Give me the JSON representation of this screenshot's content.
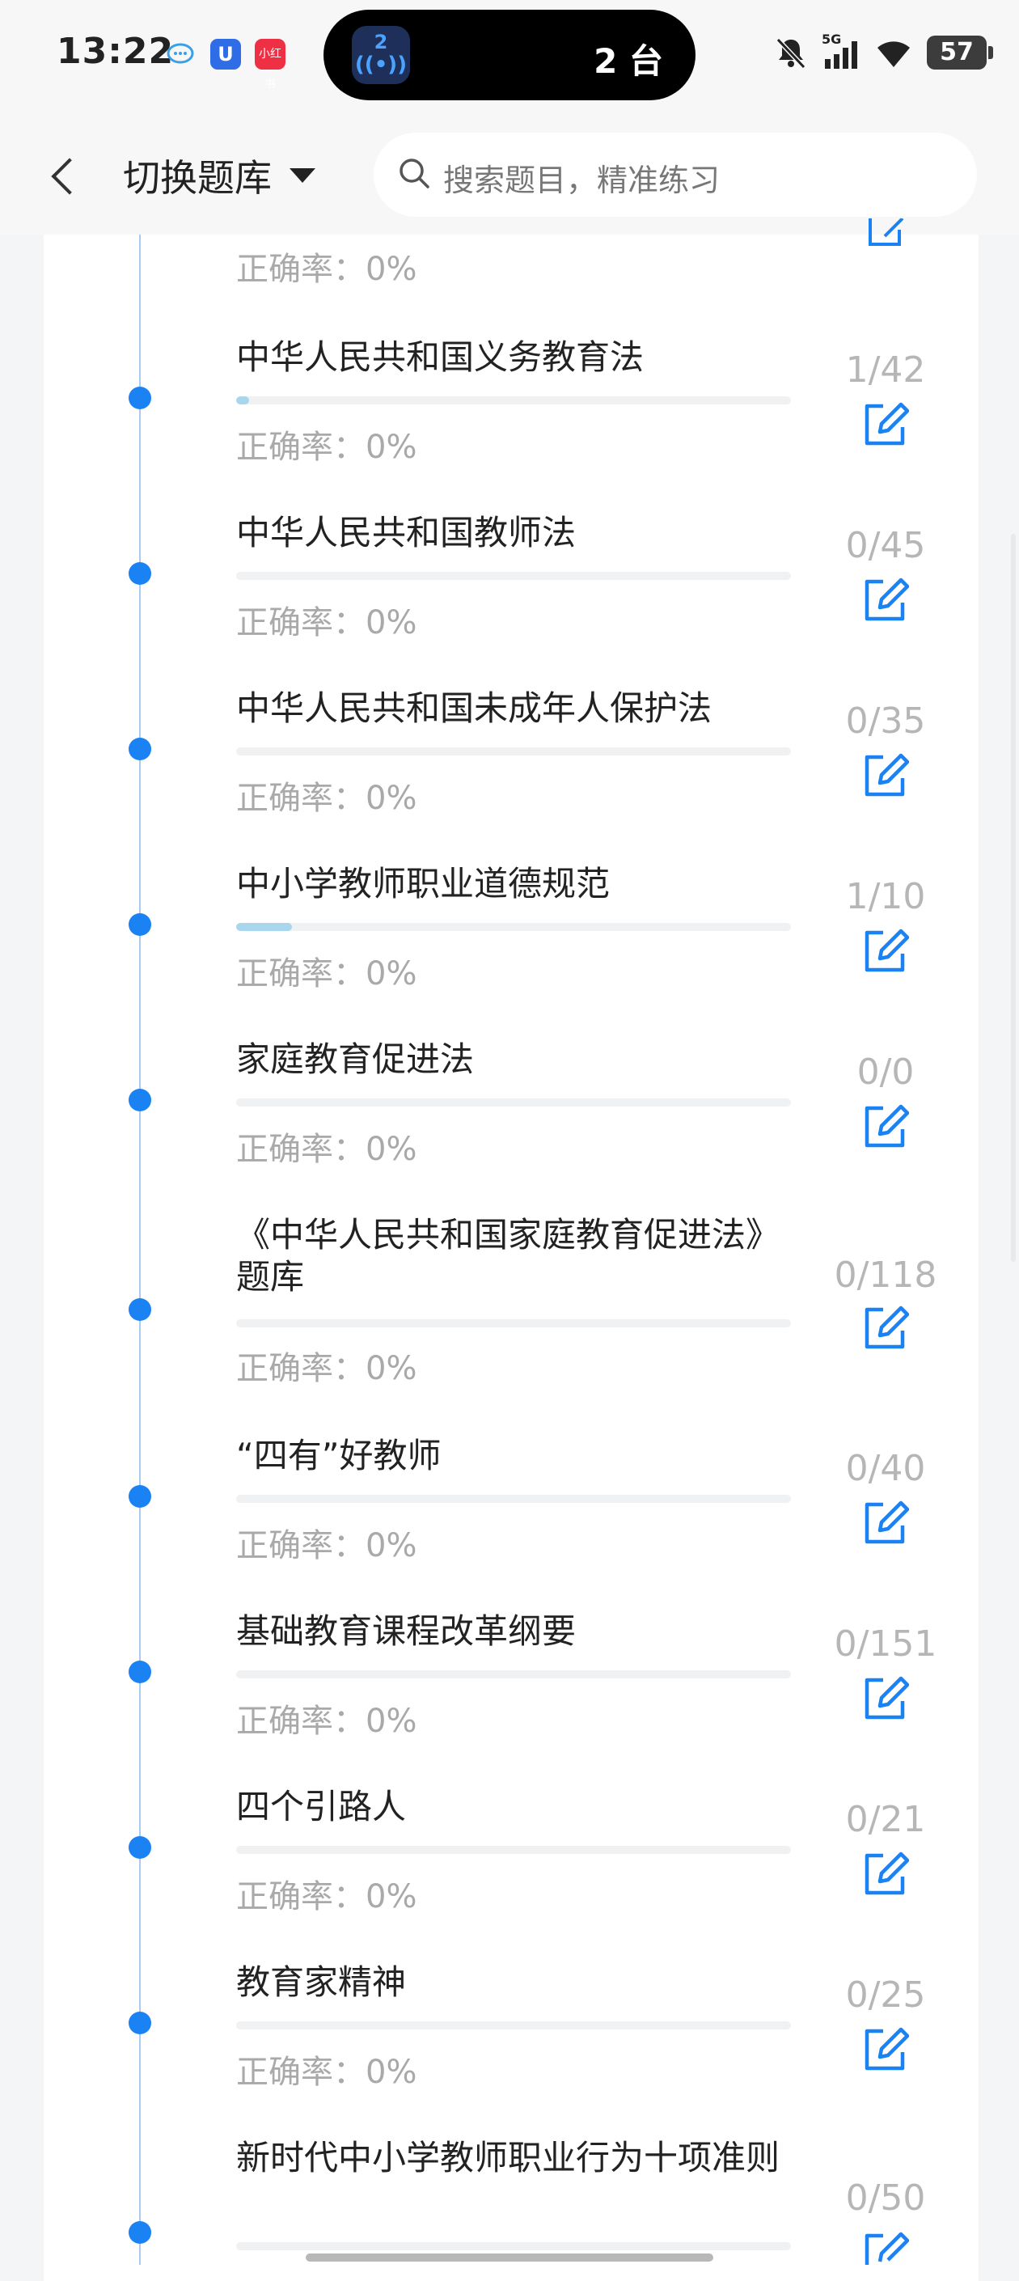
{
  "status": {
    "time": "13:22",
    "island_badge": "2",
    "island_text": "2 台",
    "battery": "57",
    "red_app_label": "小红书",
    "signal_label": "5G"
  },
  "header": {
    "switch_label": "切换题库",
    "search_placeholder": "搜索题目，精准练习"
  },
  "items": [
    {
      "title": "",
      "accuracy": "正确率：0%",
      "count": "",
      "progress": 0
    },
    {
      "title": "中华人民共和国义务教育法",
      "accuracy": "正确率：0%",
      "count": "1/42",
      "progress": 0.024
    },
    {
      "title": "中华人民共和国教师法",
      "accuracy": "正确率：0%",
      "count": "0/45",
      "progress": 0
    },
    {
      "title": "中华人民共和国未成年人保护法",
      "accuracy": "正确率：0%",
      "count": "0/35",
      "progress": 0
    },
    {
      "title": "中小学教师职业道德规范",
      "accuracy": "正确率：0%",
      "count": "1/10",
      "progress": 0.1
    },
    {
      "title": "家庭教育促进法",
      "accuracy": "正确率：0%",
      "count": "0/0",
      "progress": 0
    },
    {
      "title": "《中华人民共和国家庭教育促进法》题库",
      "accuracy": "正确率：0%",
      "count": "0/118",
      "progress": 0
    },
    {
      "title": "“四有”好教师",
      "accuracy": "正确率：0%",
      "count": "0/40",
      "progress": 0
    },
    {
      "title": "基础教育课程改革纲要",
      "accuracy": "正确率：0%",
      "count": "0/151",
      "progress": 0
    },
    {
      "title": "四个引路人",
      "accuracy": "正确率：0%",
      "count": "0/21",
      "progress": 0
    },
    {
      "title": "教育家精神",
      "accuracy": "正确率：0%",
      "count": "0/25",
      "progress": 0
    },
    {
      "title": "新时代中小学教师职业行为十项准则",
      "accuracy": "",
      "count": "0/50",
      "progress": 0
    }
  ],
  "colors": {
    "accent": "#1a82f2",
    "progress": "#a8d6ec",
    "muted": "#a9a9a9"
  }
}
